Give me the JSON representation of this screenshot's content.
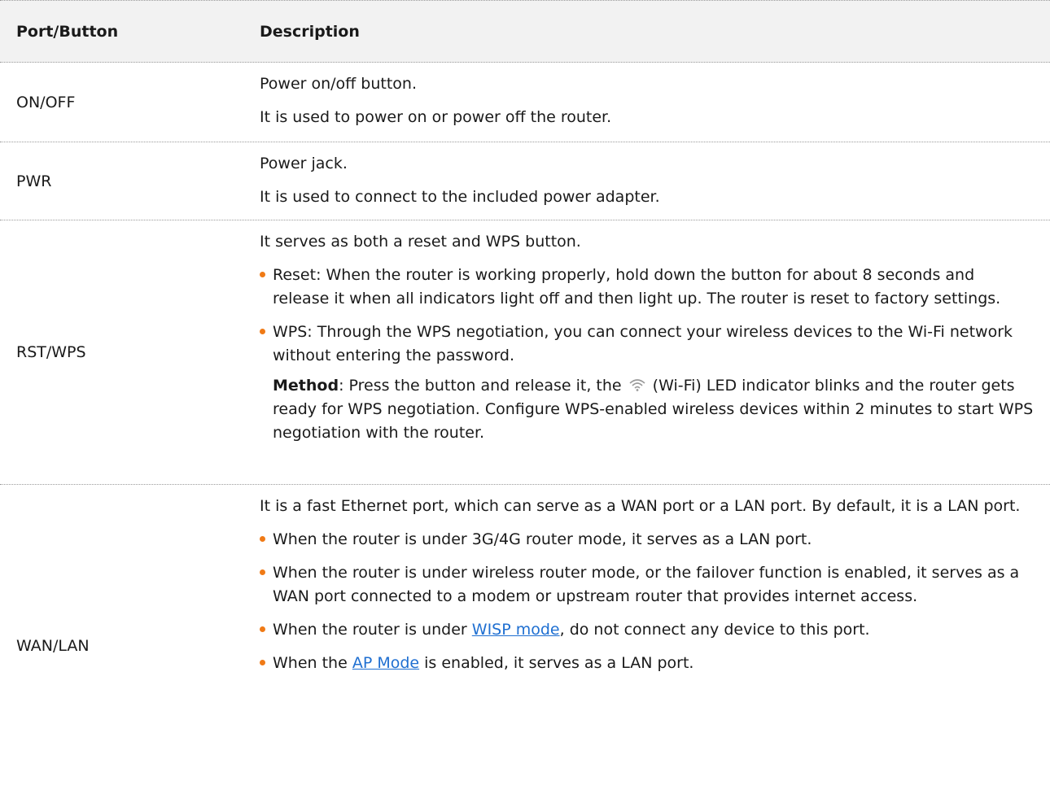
{
  "header": {
    "col1": "Port/Button",
    "col2": "Description"
  },
  "rows": [
    {
      "name": "ON/OFF",
      "lines": [
        "Power on/off button.",
        "It is used to power on or power off the router."
      ]
    },
    {
      "name": "PWR",
      "lines": [
        "Power jack.",
        "It is used to connect to the included power adapter."
      ]
    },
    {
      "name": "RST/WPS",
      "intro": "It serves as both a reset and WPS button.",
      "bullets": [
        "Reset: When the router is working properly, hold down the button for about 8 seconds and release it when all indicators light off and then light up. The router is reset to factory settings.",
        "WPS: Through the WPS negotiation, you can connect your wireless devices to the Wi-Fi network without entering the password."
      ],
      "method_label": "Method",
      "method_pre": ": Press the button and release it, the",
      "method_post": "(Wi-Fi) LED indicator blinks and the router gets ready for WPS negotiation. Configure WPS-enabled wireless devices within 2 minutes to start WPS negotiation with the router.",
      "method_icon": "wifi-icon"
    },
    {
      "name": "WAN/LAN",
      "intro": "It is a fast Ethernet port, which can serve as a WAN port or a LAN port. By default, it is a LAN port.",
      "bullet1": "When the router is under 3G/4G router mode, it serves as a LAN port.",
      "bullet2": "When the router is under wireless router mode, or the failover function is enabled, it serves as a WAN port connected to a modem or upstream router that provides internet access.",
      "bullet3_pre": "When the router is under ",
      "bullet3_link": "WISP mode",
      "bullet3_post": ", do not connect any device to this port.",
      "bullet4_pre": "When the ",
      "bullet4_link": "AP Mode",
      "bullet4_post": " is enabled, it serves as a LAN port."
    }
  ],
  "colors": {
    "bullet": "#f07a16",
    "link": "#1f6fd1",
    "header_bg": "#f2f2f2"
  }
}
